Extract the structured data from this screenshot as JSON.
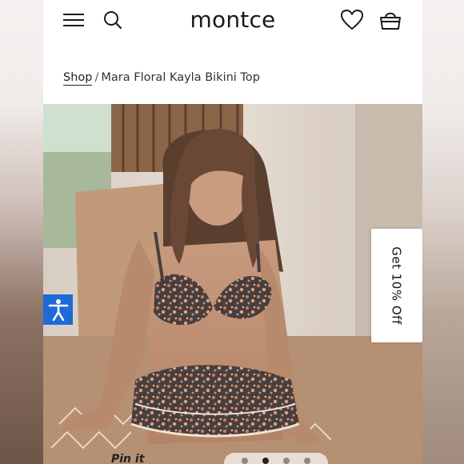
{
  "brand": {
    "logo": "montce"
  },
  "header": {
    "menu_icon": "hamburger-menu-icon",
    "search_icon": "search-icon",
    "wishlist_icon": "heart-icon",
    "cart_icon": "basket-icon"
  },
  "breadcrumb": {
    "shop": "Shop",
    "separator": "/",
    "current": "Mara Floral Kayla Bikini Top"
  },
  "promo": {
    "label": "Get 10% Off"
  },
  "accessibility": {
    "icon": "accessibility-icon",
    "color": "#1e6bd6"
  },
  "pinit": {
    "label": "Pin it"
  },
  "carousel": {
    "slides": 4,
    "active_index": 1
  }
}
